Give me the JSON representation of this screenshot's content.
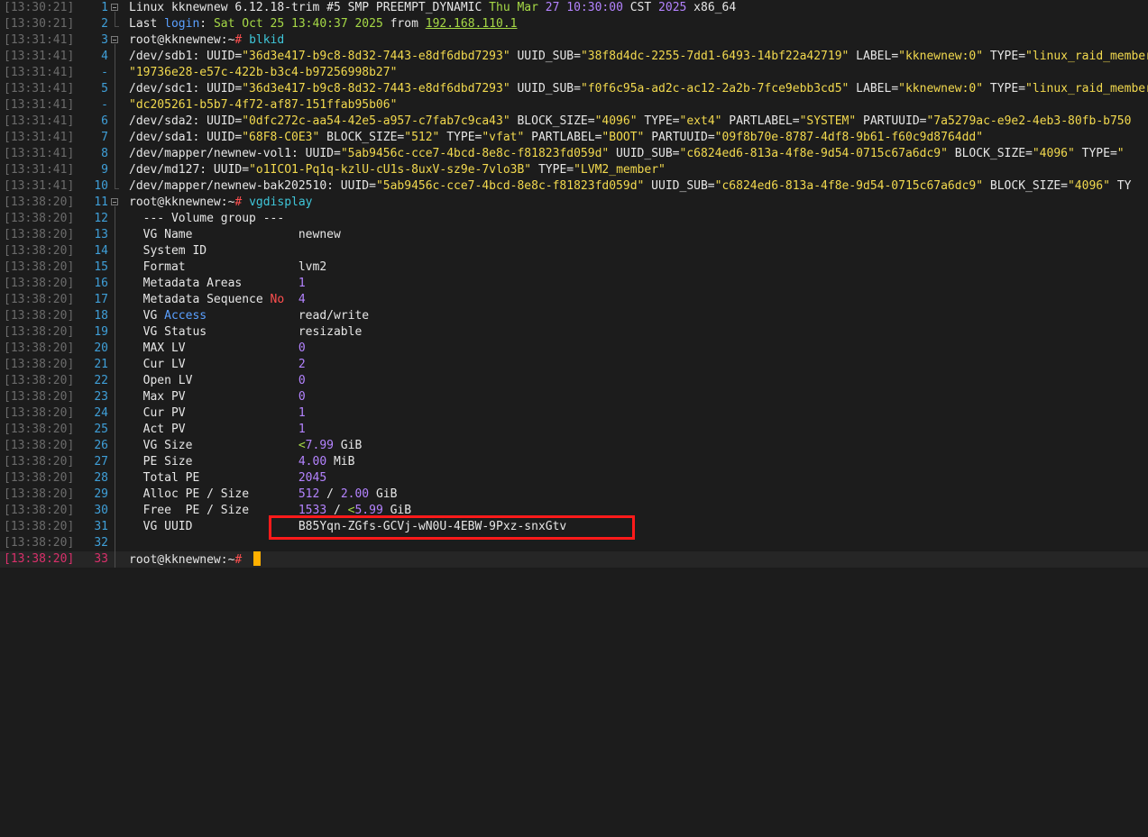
{
  "terminal": {
    "lines": [
      {
        "ts": "[13:30:21]",
        "ln": "1",
        "seg": [
          {
            "t": "Linux kknewnew 6.12.18-trim #5 SMP PREEMPT_DYNAMIC ",
            "c": "w"
          },
          {
            "t": "Thu Mar",
            "c": "g"
          },
          {
            "t": " ",
            "c": "w"
          },
          {
            "t": "27",
            "c": "n"
          },
          {
            "t": " ",
            "c": "w"
          },
          {
            "t": "10:30:00",
            "c": "n"
          },
          {
            "t": " CST ",
            "c": "w"
          },
          {
            "t": "2025",
            "c": "n"
          },
          {
            "t": " x86_64",
            "c": "w"
          }
        ]
      },
      {
        "ts": "[13:30:21]",
        "ln": "2",
        "seg": [
          {
            "t": "Last ",
            "c": "w"
          },
          {
            "t": "login",
            "c": "b"
          },
          {
            "t": ": ",
            "c": "w"
          },
          {
            "t": "Sat Oct 25 13:40:37 2025",
            "c": "g"
          },
          {
            "t": " from ",
            "c": "w"
          },
          {
            "t": "192.168.110.1",
            "c": "gu"
          }
        ]
      },
      {
        "ts": "[13:31:41]",
        "ln": "3",
        "seg": [
          {
            "t": "root@kknewnew",
            "c": "w"
          },
          {
            "t": ":~",
            "c": "w"
          },
          {
            "t": "# ",
            "c": "r"
          },
          {
            "t": "blkid",
            "c": "c"
          }
        ]
      },
      {
        "ts": "[13:31:41]",
        "ln": "4",
        "seg": [
          {
            "t": "/dev/sdb1: UUID=",
            "c": "w"
          },
          {
            "t": "\"36d3e417-b9c8-8d32-7443-e8df6dbd7293\"",
            "c": "s"
          },
          {
            "t": " UUID_SUB=",
            "c": "w"
          },
          {
            "t": "\"38f8d4dc-2255-7dd1-6493-14bf22a42719\"",
            "c": "s"
          },
          {
            "t": " LABEL=",
            "c": "w"
          },
          {
            "t": "\"kknewnew:0\"",
            "c": "s"
          },
          {
            "t": " TYPE=",
            "c": "w"
          },
          {
            "t": "\"linux_raid_member\"",
            "c": "s"
          }
        ]
      },
      {
        "ts": "[13:31:41]",
        "ln": "-",
        "seg": [
          {
            "t": "\"19736e28-e57c-422b-b3c4-b97256998b27\"",
            "c": "s"
          }
        ]
      },
      {
        "ts": "[13:31:41]",
        "ln": "5",
        "seg": [
          {
            "t": "/dev/sdc1: UUID=",
            "c": "w"
          },
          {
            "t": "\"36d3e417-b9c8-8d32-7443-e8df6dbd7293\"",
            "c": "s"
          },
          {
            "t": " UUID_SUB=",
            "c": "w"
          },
          {
            "t": "\"f0f6c95a-ad2c-ac12-2a2b-7fce9ebb3cd5\"",
            "c": "s"
          },
          {
            "t": " LABEL=",
            "c": "w"
          },
          {
            "t": "\"kknewnew:0\"",
            "c": "s"
          },
          {
            "t": " TYPE=",
            "c": "w"
          },
          {
            "t": "\"linux_raid_member\"",
            "c": "s"
          }
        ]
      },
      {
        "ts": "[13:31:41]",
        "ln": "-",
        "seg": [
          {
            "t": "\"dc205261-b5b7-4f72-af87-151ffab95b06\"",
            "c": "s"
          }
        ]
      },
      {
        "ts": "[13:31:41]",
        "ln": "6",
        "seg": [
          {
            "t": "/dev/sda2: UUID=",
            "c": "w"
          },
          {
            "t": "\"0dfc272c-aa54-42e5-a957-c7fab7c9ca43\"",
            "c": "s"
          },
          {
            "t": " BLOCK_SIZE=",
            "c": "w"
          },
          {
            "t": "\"4096\"",
            "c": "s"
          },
          {
            "t": " TYPE=",
            "c": "w"
          },
          {
            "t": "\"ext4\"",
            "c": "s"
          },
          {
            "t": " PARTLABEL=",
            "c": "w"
          },
          {
            "t": "\"SYSTEM\"",
            "c": "s"
          },
          {
            "t": " PARTUUID=",
            "c": "w"
          },
          {
            "t": "\"7a5279ac-e9e2-4eb3-80fb-b750",
            "c": "s"
          }
        ]
      },
      {
        "ts": "[13:31:41]",
        "ln": "7",
        "seg": [
          {
            "t": "/dev/sda1: UUID=",
            "c": "w"
          },
          {
            "t": "\"68F8-C0E3\"",
            "c": "s"
          },
          {
            "t": " BLOCK_SIZE=",
            "c": "w"
          },
          {
            "t": "\"512\"",
            "c": "s"
          },
          {
            "t": " TYPE=",
            "c": "w"
          },
          {
            "t": "\"vfat\"",
            "c": "s"
          },
          {
            "t": " PARTLABEL=",
            "c": "w"
          },
          {
            "t": "\"BOOT\"",
            "c": "s"
          },
          {
            "t": " PARTUUID=",
            "c": "w"
          },
          {
            "t": "\"09f8b70e-8787-4df8-9b61-f60c9d8764dd\"",
            "c": "s"
          }
        ]
      },
      {
        "ts": "[13:31:41]",
        "ln": "8",
        "seg": [
          {
            "t": "/dev/mapper/newnew-vol1: UUID=",
            "c": "w"
          },
          {
            "t": "\"5ab9456c-cce7-4bcd-8e8c-f81823fd059d\"",
            "c": "s"
          },
          {
            "t": " UUID_SUB=",
            "c": "w"
          },
          {
            "t": "\"c6824ed6-813a-4f8e-9d54-0715c67a6dc9\"",
            "c": "s"
          },
          {
            "t": " BLOCK_SIZE=",
            "c": "w"
          },
          {
            "t": "\"4096\"",
            "c": "s"
          },
          {
            "t": " TYPE=",
            "c": "w"
          },
          {
            "t": "\"",
            "c": "s"
          }
        ]
      },
      {
        "ts": "[13:31:41]",
        "ln": "9",
        "seg": [
          {
            "t": "/dev/md127: UUID=",
            "c": "w"
          },
          {
            "t": "\"o1ICO1-Pq1q-kzlU-cU1s-8uxV-sz9e-7vlo3B\"",
            "c": "s"
          },
          {
            "t": " TYPE=",
            "c": "w"
          },
          {
            "t": "\"LVM2_member\"",
            "c": "s"
          }
        ]
      },
      {
        "ts": "[13:31:41]",
        "ln": "10",
        "seg": [
          {
            "t": "/dev/mapper/newnew-bak202510: UUID=",
            "c": "w"
          },
          {
            "t": "\"5ab9456c-cce7-4bcd-8e8c-f81823fd059d\"",
            "c": "s"
          },
          {
            "t": " UUID_SUB=",
            "c": "w"
          },
          {
            "t": "\"c6824ed6-813a-4f8e-9d54-0715c67a6dc9\"",
            "c": "s"
          },
          {
            "t": " BLOCK_SIZE=",
            "c": "w"
          },
          {
            "t": "\"4096\"",
            "c": "s"
          },
          {
            "t": " TY",
            "c": "w"
          }
        ]
      },
      {
        "ts": "[13:38:20]",
        "ln": "11",
        "seg": [
          {
            "t": "root@kknewnew",
            "c": "w"
          },
          {
            "t": ":~",
            "c": "w"
          },
          {
            "t": "# ",
            "c": "r"
          },
          {
            "t": "vgdisplay",
            "c": "c"
          }
        ]
      },
      {
        "ts": "[13:38:20]",
        "ln": "12",
        "seg": [
          {
            "t": "  --- Volume group ---",
            "c": "w"
          }
        ]
      },
      {
        "ts": "[13:38:20]",
        "ln": "13",
        "seg": [
          {
            "t": "  VG Name               newnew",
            "c": "w"
          }
        ]
      },
      {
        "ts": "[13:38:20]",
        "ln": "14",
        "seg": [
          {
            "t": "  System ID",
            "c": "w"
          }
        ]
      },
      {
        "ts": "[13:38:20]",
        "ln": "15",
        "seg": [
          {
            "t": "  Format                lvm2",
            "c": "w"
          }
        ]
      },
      {
        "ts": "[13:38:20]",
        "ln": "16",
        "seg": [
          {
            "t": "  Metadata Areas        ",
            "c": "w"
          },
          {
            "t": "1",
            "c": "n"
          }
        ]
      },
      {
        "ts": "[13:38:20]",
        "ln": "17",
        "seg": [
          {
            "t": "  Metadata Sequence ",
            "c": "w"
          },
          {
            "t": "No",
            "c": "r"
          },
          {
            "t": "  ",
            "c": "w"
          },
          {
            "t": "4",
            "c": "n"
          }
        ]
      },
      {
        "ts": "[13:38:20]",
        "ln": "18",
        "seg": [
          {
            "t": "  VG ",
            "c": "w"
          },
          {
            "t": "Access",
            "c": "b"
          },
          {
            "t": "             read/write",
            "c": "w"
          }
        ]
      },
      {
        "ts": "[13:38:20]",
        "ln": "19",
        "seg": [
          {
            "t": "  VG Status             resizable",
            "c": "w"
          }
        ]
      },
      {
        "ts": "[13:38:20]",
        "ln": "20",
        "seg": [
          {
            "t": "  MAX LV                ",
            "c": "w"
          },
          {
            "t": "0",
            "c": "n"
          }
        ]
      },
      {
        "ts": "[13:38:20]",
        "ln": "21",
        "seg": [
          {
            "t": "  Cur LV                ",
            "c": "w"
          },
          {
            "t": "2",
            "c": "n"
          }
        ]
      },
      {
        "ts": "[13:38:20]",
        "ln": "22",
        "seg": [
          {
            "t": "  Open LV               ",
            "c": "w"
          },
          {
            "t": "0",
            "c": "n"
          }
        ]
      },
      {
        "ts": "[13:38:20]",
        "ln": "23",
        "seg": [
          {
            "t": "  Max PV                ",
            "c": "w"
          },
          {
            "t": "0",
            "c": "n"
          }
        ]
      },
      {
        "ts": "[13:38:20]",
        "ln": "24",
        "seg": [
          {
            "t": "  Cur PV                ",
            "c": "w"
          },
          {
            "t": "1",
            "c": "n"
          }
        ]
      },
      {
        "ts": "[13:38:20]",
        "ln": "25",
        "seg": [
          {
            "t": "  Act PV                ",
            "c": "w"
          },
          {
            "t": "1",
            "c": "n"
          }
        ]
      },
      {
        "ts": "[13:38:20]",
        "ln": "26",
        "seg": [
          {
            "t": "  VG Size               ",
            "c": "w"
          },
          {
            "t": "<",
            "c": "g"
          },
          {
            "t": "7.99",
            "c": "n"
          },
          {
            "t": " GiB",
            "c": "w"
          }
        ]
      },
      {
        "ts": "[13:38:20]",
        "ln": "27",
        "seg": [
          {
            "t": "  PE Size               ",
            "c": "w"
          },
          {
            "t": "4.00",
            "c": "n"
          },
          {
            "t": " MiB",
            "c": "w"
          }
        ]
      },
      {
        "ts": "[13:38:20]",
        "ln": "28",
        "seg": [
          {
            "t": "  Total PE              ",
            "c": "w"
          },
          {
            "t": "2045",
            "c": "n"
          }
        ]
      },
      {
        "ts": "[13:38:20]",
        "ln": "29",
        "seg": [
          {
            "t": "  Alloc PE / Size       ",
            "c": "w"
          },
          {
            "t": "512",
            "c": "n"
          },
          {
            "t": " / ",
            "c": "w"
          },
          {
            "t": "2.00",
            "c": "n"
          },
          {
            "t": " GiB",
            "c": "w"
          }
        ]
      },
      {
        "ts": "[13:38:20]",
        "ln": "30",
        "seg": [
          {
            "t": "  Free  PE / Size       ",
            "c": "w"
          },
          {
            "t": "1533",
            "c": "n"
          },
          {
            "t": " / ",
            "c": "w"
          },
          {
            "t": "<",
            "c": "g"
          },
          {
            "t": "5.99",
            "c": "n"
          },
          {
            "t": " GiB",
            "c": "w"
          }
        ]
      },
      {
        "ts": "[13:38:20]",
        "ln": "31",
        "seg": [
          {
            "t": "  VG UUID               B85Yqn-ZGfs-GCVj-wN0U-4EBW-9Pxz-snxGtv",
            "c": "w"
          }
        ]
      },
      {
        "ts": "[13:38:20]",
        "ln": "32",
        "seg": [
          {
            "t": "",
            "c": "w"
          }
        ]
      },
      {
        "ts": "[13:38:20]",
        "ln": "33",
        "seg": [
          {
            "t": "root@kknewnew",
            "c": "w"
          },
          {
            "t": ":~",
            "c": "w"
          },
          {
            "t": "# ",
            "c": "r"
          }
        ],
        "current": true
      }
    ]
  },
  "colors": {
    "background": "#1c1c1c",
    "timestamp": "#6b6b6b",
    "line_number": "#3f9fd8",
    "current_line": "#d9306b",
    "string": "#f2d94e",
    "number": "#b483ff",
    "date": "#a6d946",
    "keyword": "#5aa0ff",
    "command": "#3fc6d9",
    "prompt_hash": "#ff4f4f",
    "cursor": "#ffb000",
    "highlight_box": "#ff1a1a"
  },
  "annotation": {
    "icon": "highlight-box"
  }
}
